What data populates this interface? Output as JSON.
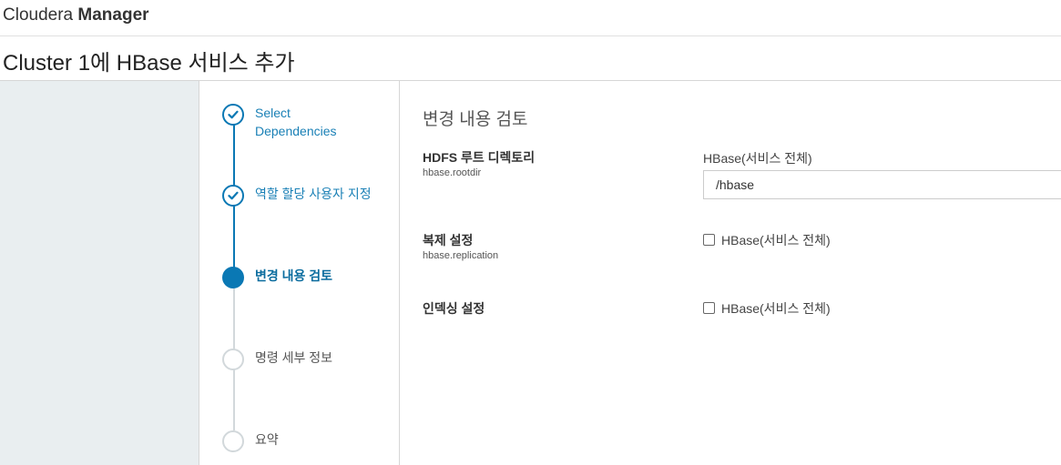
{
  "brand": {
    "name_light": "Cloudera",
    "name_bold": "Manager"
  },
  "page_title": "Cluster 1에 HBase 서비스 추가",
  "steps": [
    {
      "label": "Select Dependencies",
      "status": "completed",
      "icon": "check-icon"
    },
    {
      "label": "역할 할당 사용자 지정",
      "status": "completed",
      "icon": "check-icon"
    },
    {
      "label": "변경 내용 검토",
      "status": "current",
      "icon": "filled-circle-icon"
    },
    {
      "label": "명령 세부 정보",
      "status": "pending",
      "icon": "empty-circle-icon"
    },
    {
      "label": "요약",
      "status": "pending",
      "icon": "empty-circle-icon"
    }
  ],
  "review": {
    "title": "변경 내용 검토",
    "properties": [
      {
        "name": "HDFS 루트 디렉토리",
        "key": "hbase.rootdir",
        "scope": "HBase(서비스 전체)",
        "value": "/hbase"
      },
      {
        "name": "복제 설정",
        "key": "hbase.replication",
        "scope": "HBase(서비스 전체)",
        "checked": false
      },
      {
        "name": "인덱싱 설정",
        "key": "",
        "scope": "HBase(서비스 전체)",
        "checked": false
      }
    ]
  },
  "colors": {
    "accent": "#0a78b4",
    "step_link": "#1a80b6",
    "pending": "#d2d8db",
    "sidebar_bg": "#e9eef0"
  }
}
